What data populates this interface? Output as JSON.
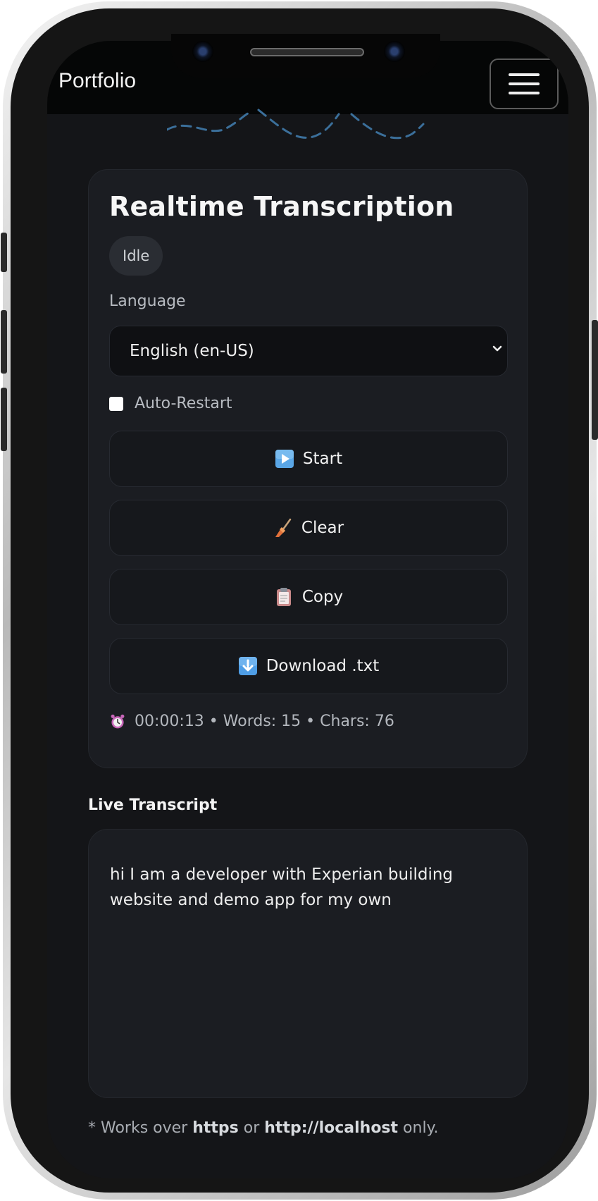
{
  "navbar": {
    "brand": "Portfolio"
  },
  "card": {
    "title": "Realtime Transcription",
    "status": "Idle",
    "language_label": "Language",
    "language_selected": "English (en-US)",
    "auto_restart_label": "Auto-Restart",
    "auto_restart_checked": false,
    "buttons": {
      "start": "Start",
      "clear": "Clear",
      "copy": "Copy",
      "download": "Download .txt"
    },
    "stats": "00:00:13 • Words: 15 • Chars: 76"
  },
  "transcript": {
    "title": "Live Transcript",
    "text": "hi I am a developer with Experian building website and demo app for my own"
  },
  "footnote": {
    "prefix": "* Works over ",
    "https": "https",
    "or": " or ",
    "localhost": "http://localhost",
    "suffix": " only."
  },
  "colors": {
    "background": "#141518",
    "card": "#1b1d22",
    "accent_wave": "#3b6f9a"
  },
  "icons": {
    "start": "play-icon",
    "clear": "broom-icon",
    "copy": "clipboard-icon",
    "download": "download-icon",
    "stats": "alarm-clock-icon",
    "menu": "hamburger-icon",
    "select": "chevron-down-icon"
  }
}
